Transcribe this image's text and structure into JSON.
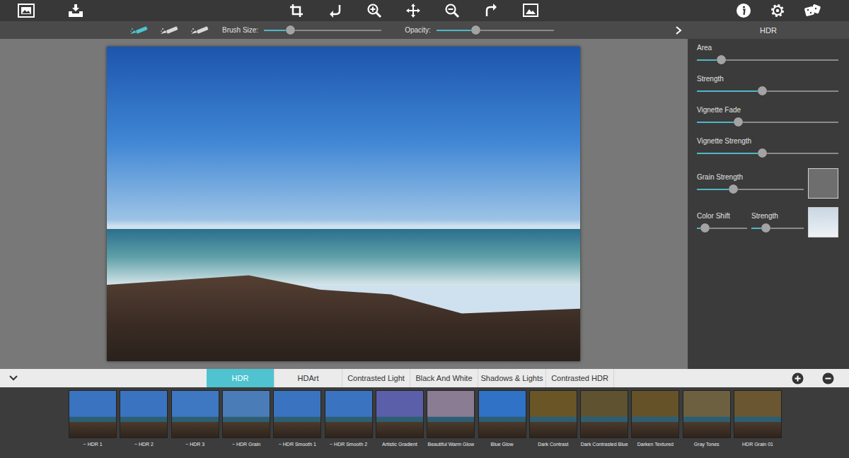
{
  "brush_tools": [
    {
      "selected": true
    },
    {
      "selected": false
    },
    {
      "selected": false
    }
  ],
  "brush_size": {
    "label": "Brush Size:",
    "level": 0.22
  },
  "opacity": {
    "label": "Opacity:",
    "level": 0.33
  },
  "panel": {
    "title": "HDR",
    "controls": [
      {
        "kind": "slider",
        "label": "Area",
        "level": 0.17
      },
      {
        "kind": "slider",
        "label": "Strength",
        "level": 0.46
      },
      {
        "kind": "slider",
        "label": "Vignette Fade",
        "level": 0.29
      },
      {
        "kind": "slider",
        "label": "Vignette Strength",
        "level": 0.46
      },
      {
        "kind": "swatch",
        "label": "Grain Strength",
        "level": 0.34,
        "color": "#6e6e6e"
      },
      {
        "kind": "pair",
        "label": "Color Shift",
        "level": 0.15,
        "second_label": "Strength",
        "second_level": 0.27,
        "color": "#c9d6e2"
      }
    ]
  },
  "tabs": [
    {
      "label": "HDR",
      "selected": true
    },
    {
      "label": "HDArt",
      "selected": false
    },
    {
      "label": "Contrasted Light",
      "selected": false
    },
    {
      "label": "Black And White",
      "selected": false
    },
    {
      "label": "Shadows & Lights",
      "selected": false
    },
    {
      "label": "Contrasted HDR",
      "selected": false
    }
  ],
  "presets": [
    {
      "label": "~ HDR 1",
      "color": "#3a74c0"
    },
    {
      "label": "~ HDR 2",
      "color": "#3a74c0"
    },
    {
      "label": "~ HDR 3",
      "color": "#3f78c2"
    },
    {
      "label": "~ HDR Grain",
      "color": "#4a7cb8"
    },
    {
      "label": "~ HDR Smooth 1",
      "color": "#3a74c0"
    },
    {
      "label": "~ HDR Smooth 2",
      "color": "#3a74c0"
    },
    {
      "label": "Artistic Gradient",
      "color": "#5b5ea8"
    },
    {
      "label": "Beautiful Warm Glow",
      "color": "#8a7c92"
    },
    {
      "label": "Blue Glow",
      "color": "#2f72c6"
    },
    {
      "label": "Dark Contrast",
      "color": "#6a5526"
    },
    {
      "label": "Dark Contrasted Blue",
      "color": "#5e5230"
    },
    {
      "label": "Darken Textured",
      "color": "#665228"
    },
    {
      "label": "Gray Tones",
      "color": "#6c6040"
    },
    {
      "label": "HDR Grain 01",
      "color": "#6a5630"
    }
  ]
}
